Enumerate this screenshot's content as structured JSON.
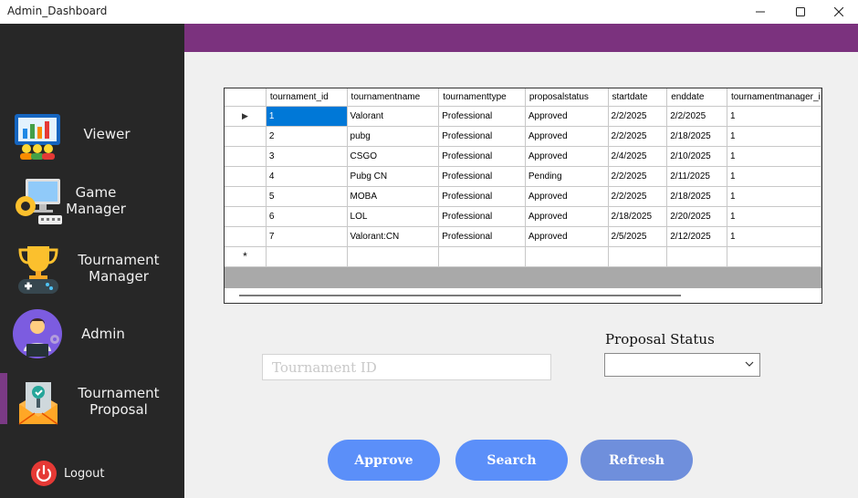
{
  "window": {
    "title": "Admin_Dashboard"
  },
  "sidebar": {
    "items": [
      {
        "label": "Viewer",
        "icon": "viewer-monitor-icon"
      },
      {
        "label": "Game\nManager",
        "icon": "gear-monitor-icon"
      },
      {
        "label": "Tournament\nManager",
        "icon": "trophy-icon"
      },
      {
        "label": "Admin",
        "icon": "admin-avatar-icon"
      },
      {
        "label": "Tournament\nProposal",
        "icon": "proposal-envelope-icon"
      }
    ],
    "logout": {
      "label": "Logout",
      "icon": "power-icon"
    },
    "active_item": "Tournament\nProposal"
  },
  "grid": {
    "columns": [
      "tournament_id",
      "tournamentname",
      "tournamenttype",
      "proposalstatus",
      "startdate",
      "enddate",
      "tournamentmanager_i"
    ],
    "rows": [
      [
        "1",
        "Valorant",
        "Professional",
        "Approved",
        "2/2/2025",
        "2/2/2025",
        "1"
      ],
      [
        "2",
        "pubg",
        "Professional",
        "Approved",
        "2/2/2025",
        "2/18/2025",
        "1"
      ],
      [
        "3",
        "CSGO",
        "Professional",
        "Approved",
        "2/4/2025",
        "2/10/2025",
        "1"
      ],
      [
        "4",
        "Pubg CN",
        "Professional",
        "Pending",
        "2/2/2025",
        "2/11/2025",
        "1"
      ],
      [
        "5",
        "MOBA",
        "Professional",
        "Approved",
        "2/2/2025",
        "2/18/2025",
        "1"
      ],
      [
        "6",
        "LOL",
        "Professional",
        "Approved",
        "2/18/2025",
        "2/20/2025",
        "1"
      ],
      [
        "7",
        "Valorant:CN",
        "Professional",
        "Approved",
        "2/5/2025",
        "2/12/2025",
        "1"
      ]
    ],
    "current_row_marker": "▶",
    "new_row_marker": "*"
  },
  "form": {
    "tournament_id": {
      "value": "",
      "placeholder": "Tournament ID"
    },
    "proposal_status": {
      "label": "Proposal Status",
      "value": ""
    }
  },
  "buttons": {
    "approve": "Approve",
    "search": "Search",
    "refresh": "Refresh"
  },
  "colors": {
    "sidebar": "#272727",
    "accent": "#7b327e",
    "button": "#5b8ff9",
    "selection": "#0078d7"
  }
}
